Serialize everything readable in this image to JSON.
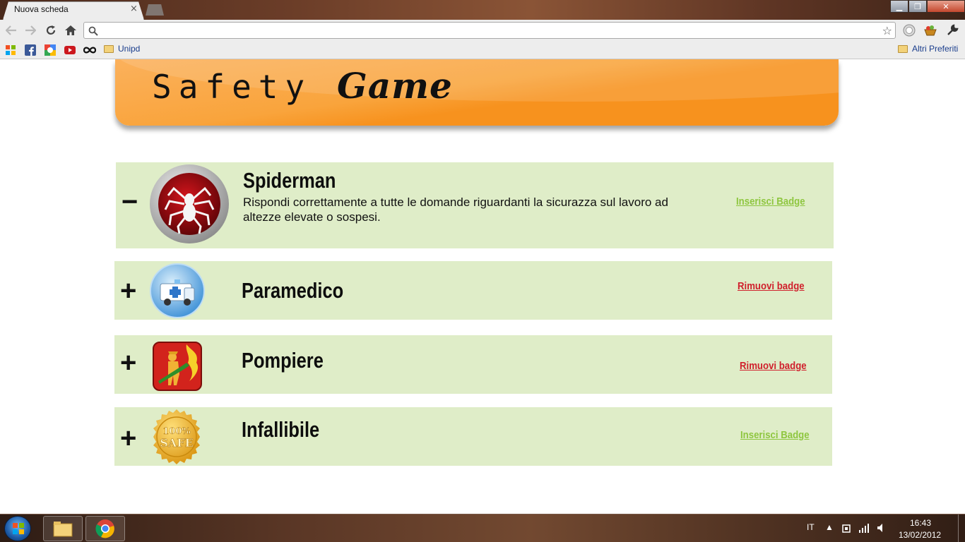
{
  "browser": {
    "tab_title": "Nuova scheda",
    "tab_close": "×",
    "window_buttons": {
      "minimize": "▁",
      "maximize": "❐",
      "close": "✕"
    },
    "address_value": "",
    "star": "☆"
  },
  "bookmarks": {
    "folder_unipd": "Unipd",
    "other_bookmarks": "Altri Preferiti"
  },
  "banner": {
    "title_part1": "Safety",
    "title_part2": "Game",
    "color": "#f7921e"
  },
  "badges": [
    {
      "toggle": "−",
      "name": "Spiderman",
      "description": "Rispondi correttamente a tutte le domande riguardanti la sicurazza sul lavoro ad altezze elevate o sospesi.",
      "action": "Inserisci Badge",
      "icon": "spider-icon"
    },
    {
      "toggle": "+",
      "name": "Paramedico",
      "action": "Rimuovi badge",
      "icon": "ambulance-icon"
    },
    {
      "toggle": "+",
      "name": "Pompiere",
      "action": "Rimuovi badge",
      "icon": "firefighter-icon"
    },
    {
      "toggle": "+",
      "name": "Infallibile",
      "action": "Inserisci Badge",
      "icon": "safe-seal-icon",
      "seal_text_top": "100%",
      "seal_text_bottom": "SAFE"
    }
  ],
  "colors": {
    "row_bg": "#dfedc8",
    "insert_link": "#8ec63f",
    "remove_link": "#d0202c"
  },
  "taskbar": {
    "language": "IT",
    "time": "16:43",
    "date": "13/02/2012"
  }
}
